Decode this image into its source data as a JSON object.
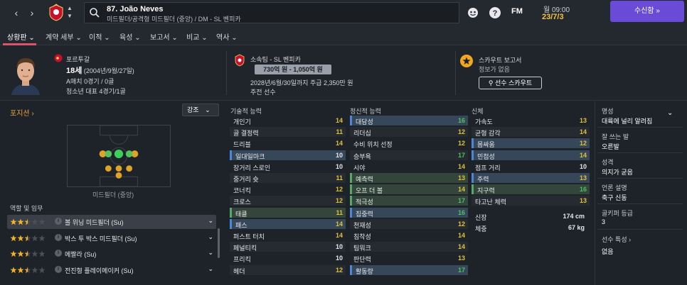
{
  "topbar": {
    "player_title": "87. João Neves",
    "player_sub": "미드필더/공격형 미드필더 (중앙) / DM - SL 벤피카",
    "fm_logo": "FM",
    "date_day": "월 09:00",
    "date_full": "23/7/3",
    "continue_label": "수신함 »"
  },
  "tabs": [
    "상황판",
    "계약 세부",
    "이적",
    "육성",
    "보고서",
    "비교",
    "역사"
  ],
  "header": {
    "nationality": "포르투갈",
    "age": "18세",
    "dob": "(2004년/9월/27일)",
    "caps": "A매치 0경기 / 0골",
    "youth": "청소년 대표 4경기/1골",
    "club_label": "소속팀 - SL 벤피카",
    "value": "730억 원 - 1,050억 원",
    "contract": "2028년/6월/30일까지 주급 2,350만 원",
    "squad_status": "주전 선수",
    "scout_title": "스카우트 보고서",
    "scout_none": "정보가 없음",
    "scout_btn": "선수 스카우트"
  },
  "position": {
    "link": "포지션 ›",
    "emphasis": "강조",
    "label": "미드필더 (중앙)"
  },
  "roles": {
    "title": "역할 및 임무",
    "items": [
      {
        "stars": 2.5,
        "name": "볼 위닝 미드필더 (Su)"
      },
      {
        "stars": 2.5,
        "name": "박스 투 박스 미드필더 (Su)"
      },
      {
        "stars": 2.5,
        "name": "메짤라 (Su)"
      },
      {
        "stars": 2.5,
        "name": "전진형 플레이메이커 (Su)"
      }
    ]
  },
  "technical": {
    "title": "기술적 능력",
    "items": [
      {
        "n": "개인기",
        "v": "14"
      },
      {
        "n": "골 결정력",
        "v": "11"
      },
      {
        "n": "드리블",
        "v": "14"
      },
      {
        "n": "일대일마크",
        "v": "10"
      },
      {
        "n": "장거리 스로인",
        "v": "10"
      },
      {
        "n": "중거리 슛",
        "v": "11"
      },
      {
        "n": "코너킥",
        "v": "12"
      },
      {
        "n": "크로스",
        "v": "12"
      },
      {
        "n": "태클",
        "v": "11"
      },
      {
        "n": "패스",
        "v": "14"
      },
      {
        "n": "퍼스트 터치",
        "v": "14"
      },
      {
        "n": "페널티킥",
        "v": "10"
      },
      {
        "n": "프리킥",
        "v": "10"
      },
      {
        "n": "헤더",
        "v": "12"
      }
    ]
  },
  "mental": {
    "title": "정신적 능력",
    "items": [
      {
        "n": "대담성",
        "v": "16"
      },
      {
        "n": "리더십",
        "v": "12"
      },
      {
        "n": "수비 위치 선정",
        "v": "12"
      },
      {
        "n": "승부욕",
        "v": "17"
      },
      {
        "n": "시야",
        "v": "14"
      },
      {
        "n": "예측력",
        "v": "13"
      },
      {
        "n": "오프 더 볼",
        "v": "14"
      },
      {
        "n": "적극성",
        "v": "17"
      },
      {
        "n": "집중력",
        "v": "16"
      },
      {
        "n": "천재성",
        "v": "12"
      },
      {
        "n": "침착성",
        "v": "14"
      },
      {
        "n": "팀워크",
        "v": "14"
      },
      {
        "n": "판단력",
        "v": "13"
      },
      {
        "n": "활동량",
        "v": "17"
      }
    ]
  },
  "physical": {
    "title": "신체",
    "items": [
      {
        "n": "가속도",
        "v": "13"
      },
      {
        "n": "균형 감각",
        "v": "14"
      },
      {
        "n": "몸싸움",
        "v": "12"
      },
      {
        "n": "민첩성",
        "v": "14"
      },
      {
        "n": "점프 거리",
        "v": "10"
      },
      {
        "n": "주력",
        "v": "13"
      },
      {
        "n": "지구력",
        "v": "16"
      },
      {
        "n": "타고난 체력",
        "v": "13"
      }
    ],
    "height_label": "신장",
    "height": "174 cm",
    "weight_label": "체중",
    "weight": "67 kg"
  },
  "right": {
    "rep_label": "명성",
    "rep_value": "대륙에 널리 알려짐",
    "foot_label": "잘 쓰는 발",
    "foot_value": "오른발",
    "personality_label": "성격",
    "personality_value": "의지가 굳음",
    "media_label": "언론 설명",
    "media_value": "축구 신동",
    "injury_label": "골키퍼 등급",
    "injury_value": "3",
    "traits_label": "선수 특성 ›",
    "traits_value": "없음"
  },
  "colors": {
    "accent": "#e0526b",
    "purple": "#6a4bd8",
    "gold": "#f4c542",
    "green": "#4ec25e",
    "yellow": "#e0c23a"
  }
}
